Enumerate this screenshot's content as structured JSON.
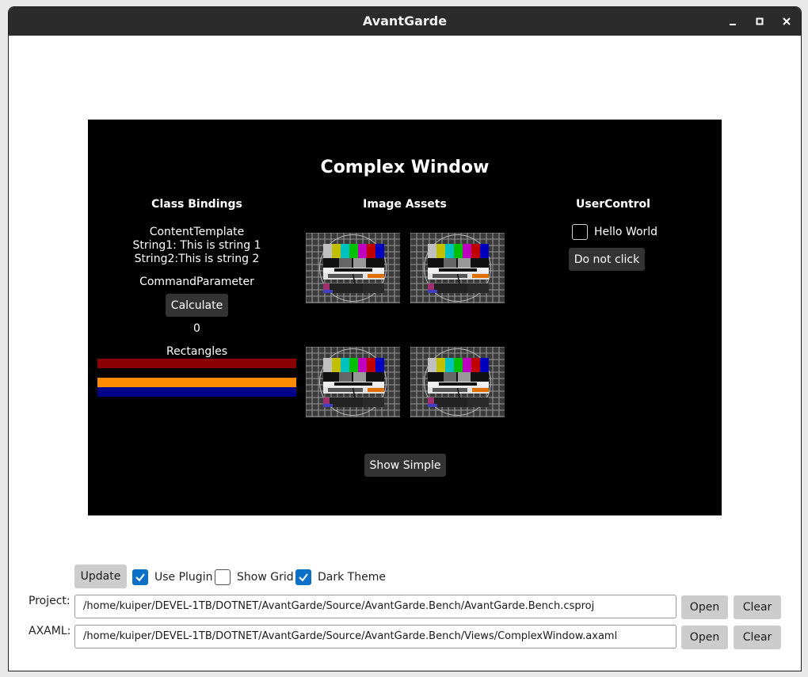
{
  "window": {
    "title": "AvantGarde"
  },
  "preview": {
    "heading": "Complex Window",
    "class_bindings": {
      "title": "Class Bindings",
      "content_template": "ContentTemplate",
      "string1": "String1: This is string 1",
      "string2": "String2:This is string 2",
      "command_parameter": "CommandParameter",
      "calculate_label": "Calculate",
      "result": "0",
      "rectangles_label": "Rectangles",
      "rectangle_colors": [
        "#8b0000",
        "#ff8c00",
        "#00008b"
      ]
    },
    "image_assets": {
      "title": "Image Assets",
      "image_count": 4
    },
    "user_control": {
      "title": "UserControl",
      "hello_world_label": "Hello World",
      "hello_world_checked": false,
      "do_not_click_label": "Do not click"
    },
    "show_simple_label": "Show Simple"
  },
  "footer": {
    "update_label": "Update",
    "use_plugin": {
      "label": "Use Plugin",
      "checked": true
    },
    "show_grid": {
      "label": "Show Grid",
      "checked": false
    },
    "dark_theme": {
      "label": "Dark Theme",
      "checked": true
    },
    "project_label": "Project:",
    "project_path": "/home/kuiper/DEVEL-1TB/DOTNET/AvantGarde/Source/AvantGarde.Bench/AvantGarde.Bench.csproj",
    "axaml_label": "AXAML:",
    "axaml_path": "/home/kuiper/DEVEL-1TB/DOTNET/AvantGarde/Source/AvantGarde.Bench/Views/ComplexWindow.axaml",
    "open_label": "Open",
    "clear_label": "Clear"
  },
  "colors": {
    "accent": "#0a70c8",
    "titlebar": "#2b2b2b",
    "preview_bg": "#000000"
  },
  "icons": [
    "minimize-icon",
    "maximize-icon",
    "close-icon",
    "checkmark-icon",
    "test-card-image"
  ]
}
